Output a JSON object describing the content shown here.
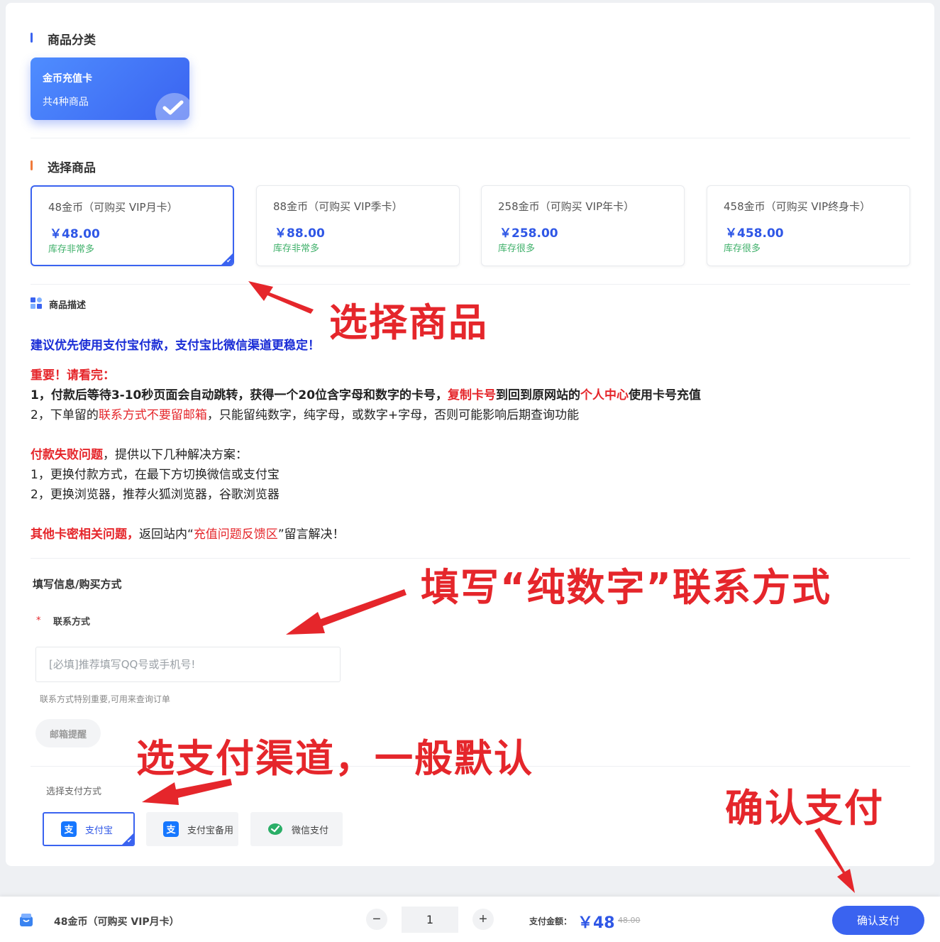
{
  "category": {
    "section_title": "商品分类",
    "card": {
      "name": "金币充值卡",
      "count": "共4种商品"
    }
  },
  "products": {
    "section_title": "选择商品",
    "items": [
      {
        "name": "48金币（可购买 VIP月卡）",
        "price": "￥48.00",
        "stock": "库存非常多",
        "selected": true
      },
      {
        "name": "88金币（可购买 VIP季卡）",
        "price": "￥88.00",
        "stock": "库存非常多",
        "selected": false
      },
      {
        "name": "258金币（可购买 VIP年卡）",
        "price": "￥258.00",
        "stock": "库存很多",
        "selected": false
      },
      {
        "name": "458金币（可购买 VIP终身卡）",
        "price": "￥458.00",
        "stock": "库存很多",
        "selected": false
      }
    ]
  },
  "description": {
    "title": "商品描述",
    "recommend": "建议优先使用支付宝付款，支付宝比微信渠道更稳定！",
    "important_head": "重要！请看完：",
    "line1_a": "1，付款后等待3-10秒页面会自动跳转，获得一个20位含字母和数字的卡号，",
    "line1_b": "复制卡号",
    "line1_c": "到回到原网站的",
    "line1_d": "个人中心",
    "line1_e": "使用卡号充值",
    "line2_a": "2，下单留的",
    "line2_b": "联系方式不要留邮箱",
    "line2_c": "，只能留纯数字，纯字母，或数字+字母，否则可能影响后期查询功能",
    "fail_head": "付款失败问题",
    "fail_tail": "，提供以下几种解决方案：",
    "fail1": "1，更换付款方式，在最下方切换微信或支付宝",
    "fail2": "2，更换浏览器，推荐火狐浏览器，谷歌浏览器",
    "other_head": "其他卡密相关问题，",
    "other_mid": "返回站内“",
    "other_link": "充值问题反馈区",
    "other_tail": "”留言解决！"
  },
  "form": {
    "title": "填写信息/购买方式",
    "required_mark": "*",
    "contact_label": "联系方式",
    "contact_placeholder": "[必填]推荐填写QQ号或手机号!",
    "contact_value": "",
    "help": "联系方式特别重要,可用来查询订单",
    "mail_button": "邮箱提醒"
  },
  "payment": {
    "title": "选择支付方式",
    "methods": [
      {
        "label": "支付宝",
        "icon": "alipay-icon",
        "selected": true
      },
      {
        "label": "支付宝备用",
        "icon": "alipay-icon",
        "selected": false
      },
      {
        "label": "微信支付",
        "icon": "wechat-pay-icon",
        "selected": false
      }
    ]
  },
  "bottom_bar": {
    "product": "48金币（可购买 VIP月卡）",
    "minus": "−",
    "quantity": "1",
    "plus": "+",
    "amount_label": "支付金额：",
    "amount": "￥48",
    "original": "48.00",
    "confirm": "确认支付"
  },
  "annotations": {
    "select_product": "选择商品",
    "fill_contact": "填写“纯数字”联系方式",
    "pay_channel": "选支付渠道，一般默认",
    "confirm_pay": "确认支付"
  },
  "colors": {
    "accent": "#3a63f0",
    "price": "#2f57e6",
    "stock": "#3fb06a",
    "warning": "#e5262b",
    "recommend": "#1a2dd6"
  }
}
